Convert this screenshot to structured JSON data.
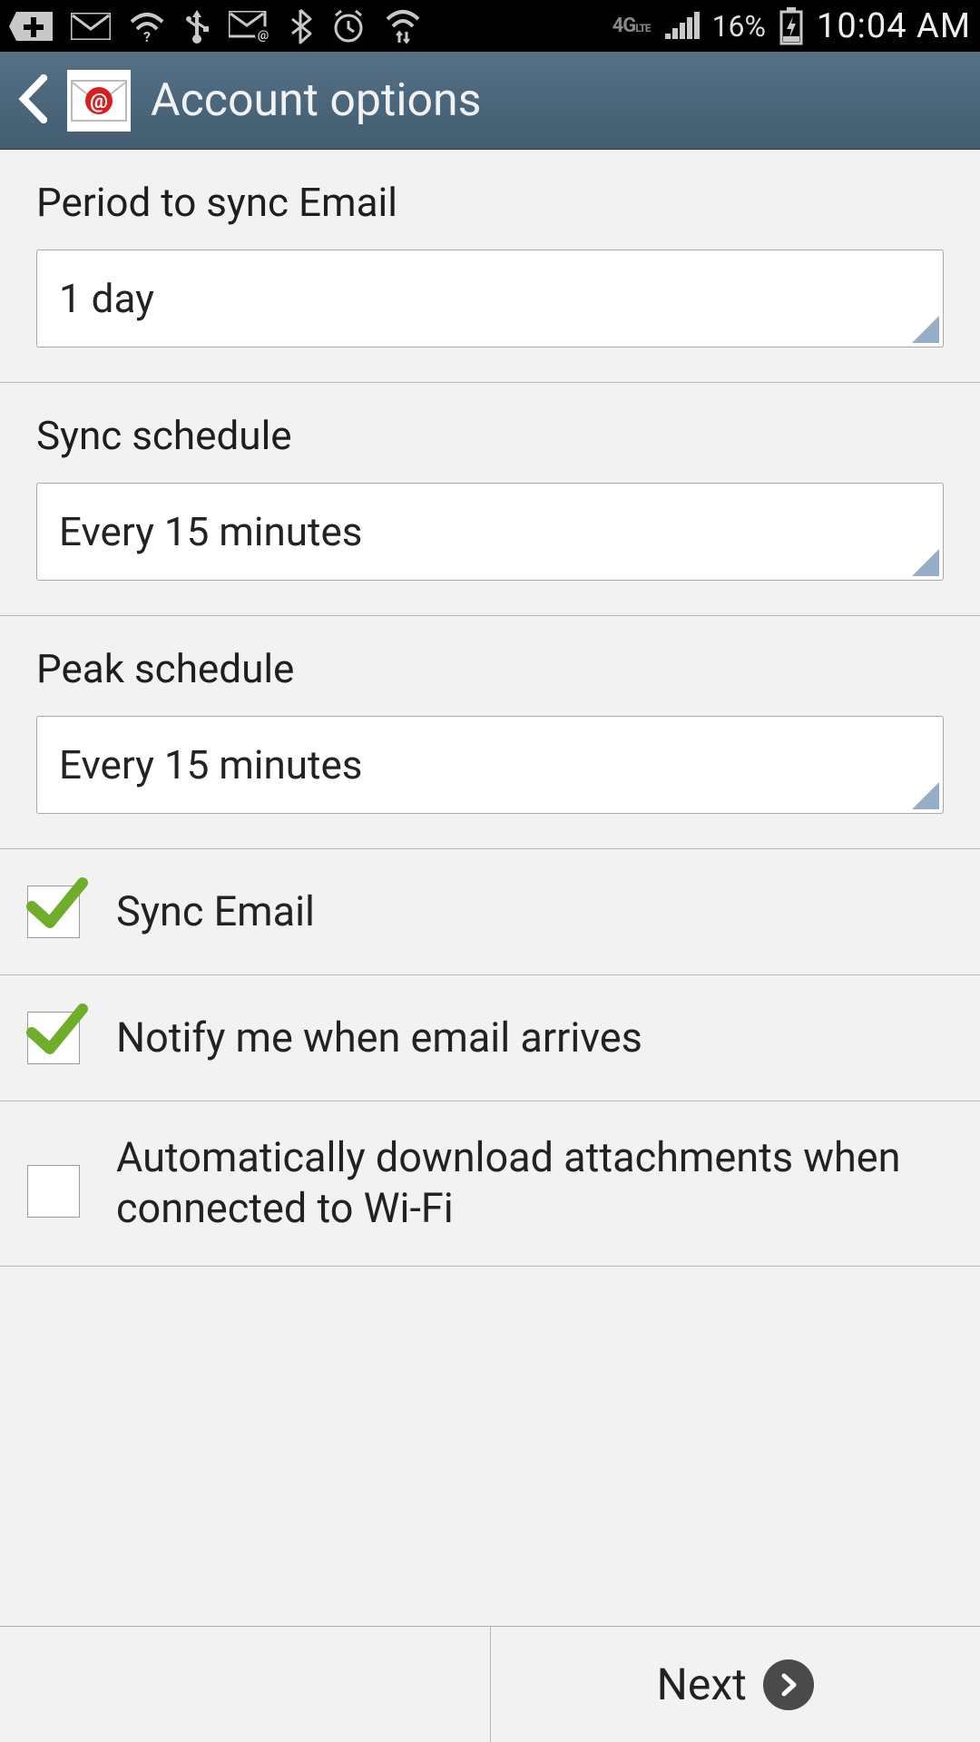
{
  "status": {
    "battery_pct": "16%",
    "time": "10:04 AM",
    "network": "4G LTE"
  },
  "header": {
    "title": "Account options"
  },
  "settings": {
    "period_label": "Period to sync Email",
    "period_value": "1 day",
    "sync_schedule_label": "Sync schedule",
    "sync_schedule_value": "Every 15 minutes",
    "peak_schedule_label": "Peak schedule",
    "peak_schedule_value": "Every 15 minutes"
  },
  "checks": {
    "sync_email": {
      "label": "Sync Email",
      "checked": true
    },
    "notify": {
      "label": "Notify me when email arrives",
      "checked": true
    },
    "auto_dl": {
      "label": "Automatically download attachments when connected to Wi-Fi",
      "checked": false
    }
  },
  "footer": {
    "next": "Next"
  }
}
